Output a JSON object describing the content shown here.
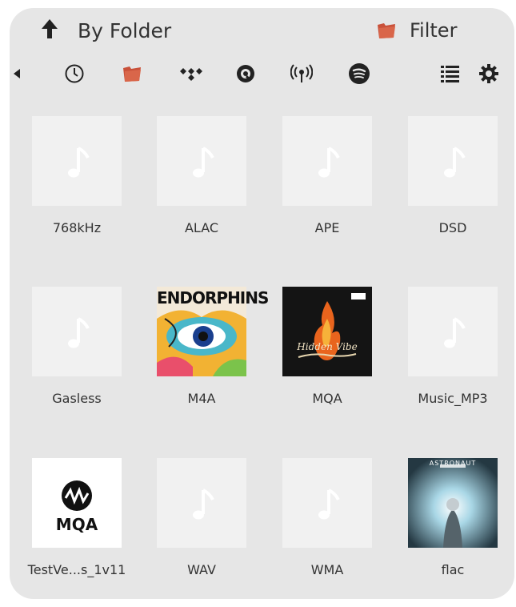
{
  "header": {
    "title": "By Folder",
    "filter_label": "Filter"
  },
  "toolbar": {
    "items": [
      "back-small-icon",
      "recent-clock-icon",
      "folder-icon",
      "tidal-icon",
      "qobuz-icon",
      "radio-icon",
      "spotify-icon",
      "list-view-icon",
      "settings-gear-icon"
    ],
    "accent_color": "#c9513a"
  },
  "folders": [
    {
      "label": "768kHz",
      "art": "placeholder"
    },
    {
      "label": "ALAC",
      "art": "placeholder"
    },
    {
      "label": "APE",
      "art": "placeholder"
    },
    {
      "label": "DSD",
      "art": "placeholder"
    },
    {
      "label": "Gasless",
      "art": "placeholder"
    },
    {
      "label": "M4A",
      "art": "cover",
      "cover_text": "ENDORPHINS"
    },
    {
      "label": "MQA",
      "art": "cover",
      "cover_text": "Hidden Vibe"
    },
    {
      "label": "Music_MP3",
      "art": "placeholder"
    },
    {
      "label": "TestVe...s_1v11",
      "art": "mqa-logo",
      "cover_text": "MQA"
    },
    {
      "label": "WAV",
      "art": "placeholder"
    },
    {
      "label": "WMA",
      "art": "placeholder"
    },
    {
      "label": "flac",
      "art": "cover",
      "cover_text": "ASTRONAUT"
    }
  ]
}
